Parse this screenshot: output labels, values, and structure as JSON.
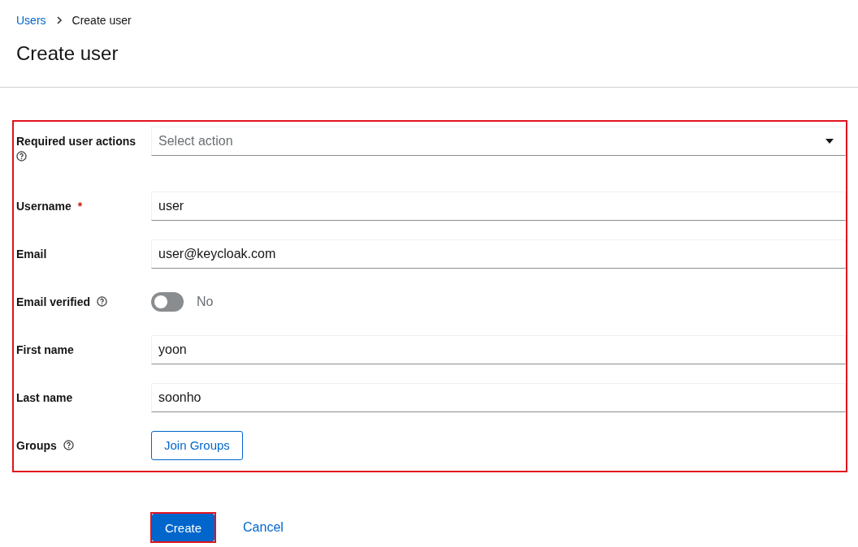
{
  "breadcrumb": [
    {
      "label": "Users",
      "link": true
    },
    {
      "label": "Create user",
      "link": false
    }
  ],
  "title": "Create user",
  "fields": [
    {
      "kind": "select",
      "label": "Required user actions",
      "help": true,
      "placeholder": "Select action"
    },
    {
      "kind": "text",
      "label": "Username",
      "help": false,
      "required_mark": "*",
      "value": "user"
    },
    {
      "kind": "text",
      "label": "Email",
      "help": false,
      "value": "user@keycloak.com"
    },
    {
      "kind": "switch",
      "label": "Email verified",
      "help": true,
      "on": false,
      "state_label": "No"
    },
    {
      "kind": "text",
      "label": "First name",
      "help": false,
      "value": "yoon"
    },
    {
      "kind": "text",
      "label": "Last name",
      "help": false,
      "value": "soonho"
    },
    {
      "kind": "button",
      "label": "Groups",
      "help": true,
      "button": "Join Groups"
    }
  ],
  "actions": {
    "primary": "Create",
    "secondary": "Cancel"
  }
}
